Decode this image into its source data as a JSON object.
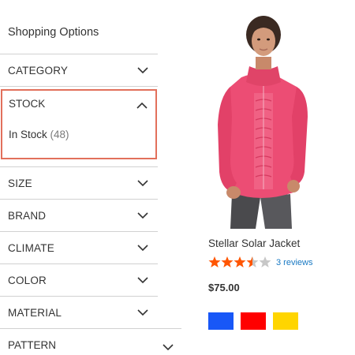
{
  "sidebar": {
    "title": "Shopping Options",
    "filters": [
      {
        "label": "CATEGORY"
      },
      {
        "label": "STOCK",
        "expanded": true,
        "options": [
          {
            "label": "In Stock",
            "count": "(48)"
          }
        ]
      },
      {
        "label": "SIZE"
      },
      {
        "label": "BRAND"
      },
      {
        "label": "CLIMATE"
      },
      {
        "label": "COLOR"
      },
      {
        "label": "MATERIAL"
      },
      {
        "label": "PATTERN"
      }
    ],
    "highlight_color": "#e2705b"
  },
  "product": {
    "name": "Stellar Solar Jacket",
    "rating_fraction": 0.7,
    "star_color": "#ff5501",
    "reviews_label": "3 reviews",
    "price": "$75.00",
    "swatches": [
      {
        "name": "Blue",
        "color": "#1857f7"
      },
      {
        "name": "Red",
        "color": "#ff0000"
      },
      {
        "name": "Yellow",
        "color": "#ffd500"
      }
    ]
  },
  "icons": {
    "collapsed": "chevron-down-icon",
    "expanded": "chevron-up-icon"
  }
}
